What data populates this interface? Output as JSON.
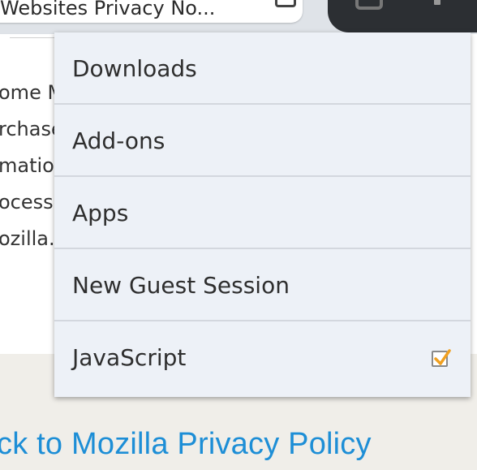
{
  "toolbar": {
    "url_title": "Websites Privacy No...",
    "reader_icon": "reader-view-icon",
    "tabs_icon": "tabs-icon",
    "menu_icon": "overflow-menu-icon"
  },
  "content": {
    "lines": [
      "ome Mo",
      "rchase",
      "mation",
      "ocesse",
      "ozilla."
    ]
  },
  "footer": {
    "link_text": "ck to Mozilla Privacy Policy"
  },
  "menu": {
    "items": [
      {
        "label": "Downloads"
      },
      {
        "label": "Add-ons"
      },
      {
        "label": "Apps"
      },
      {
        "label": "New Guest Session"
      },
      {
        "label": "JavaScript",
        "checked": true
      }
    ]
  },
  "colors": {
    "link": "#1d8ed6",
    "menu_bg": "#edf1f7",
    "chrome_dark": "#2c2f33",
    "checkmark": "#f0a020"
  }
}
